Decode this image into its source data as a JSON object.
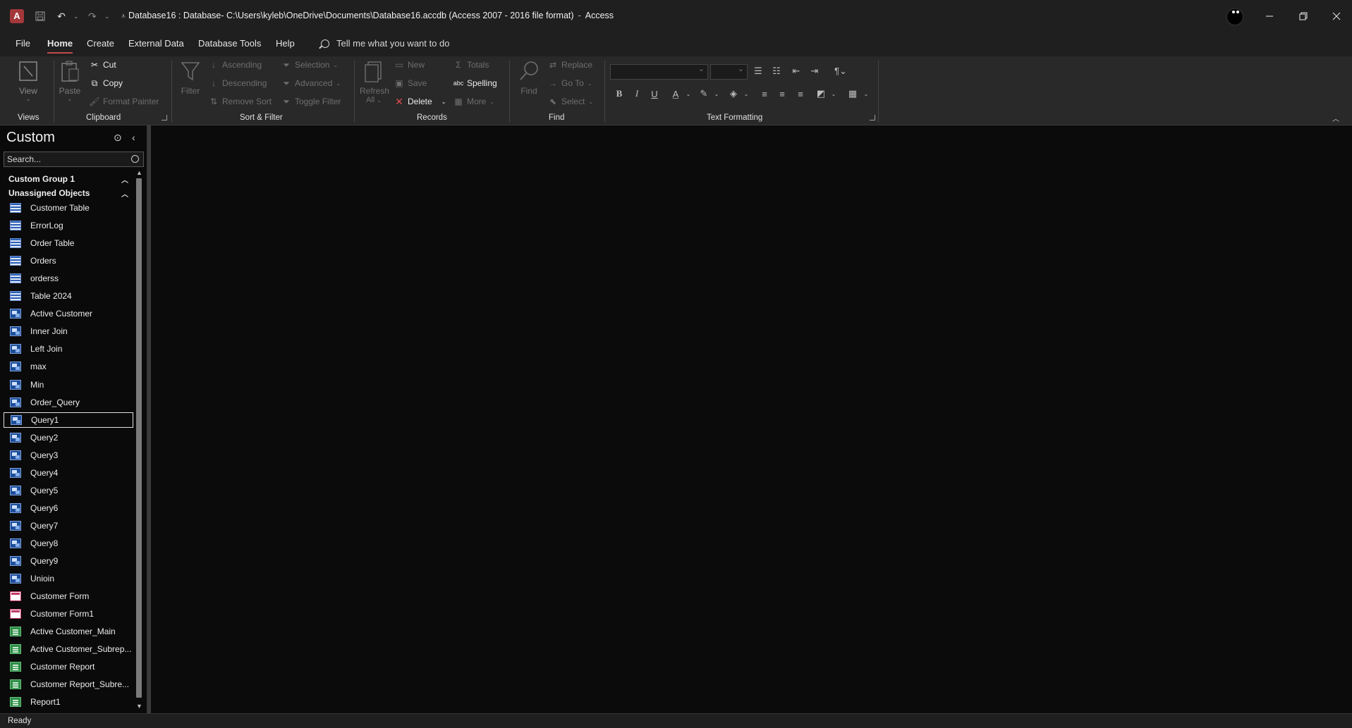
{
  "window": {
    "title_doc": "Database16 : Database- C:\\Users\\kyleb\\OneDrive\\Documents\\Database16.accdb (Access 2007 - 2016 file format)",
    "title_sep": "-",
    "title_app": "Access",
    "app_logo": "A"
  },
  "menu": {
    "tabs": [
      "File",
      "Home",
      "Create",
      "External Data",
      "Database Tools",
      "Help"
    ],
    "active_tab": "Home",
    "tellme_placeholder": "Tell me what you want to do"
  },
  "ribbon": {
    "views": {
      "view_label": "View",
      "group_label": "Views"
    },
    "clipboard": {
      "paste_label": "Paste",
      "cut_label": "Cut",
      "copy_label": "Copy",
      "format_painter_label": "Format Painter",
      "group_label": "Clipboard"
    },
    "sort_filter": {
      "filter_label": "Filter",
      "ascending_label": "Ascending",
      "descending_label": "Descending",
      "remove_sort_label": "Remove Sort",
      "selection_label": "Selection",
      "advanced_label": "Advanced",
      "toggle_filter_label": "Toggle Filter",
      "group_label": "Sort & Filter"
    },
    "records": {
      "refresh_label": "Refresh",
      "refresh_sub": "All",
      "new_label": "New",
      "save_label": "Save",
      "delete_label": "Delete",
      "totals_label": "Totals",
      "spelling_label": "Spelling",
      "more_label": "More",
      "group_label": "Records"
    },
    "find": {
      "find_label": "Find",
      "replace_label": "Replace",
      "goto_label": "Go To",
      "select_label": "Select",
      "group_label": "Find"
    },
    "text_formatting": {
      "bold": "B",
      "italic": "I",
      "underline": "U",
      "font_color": "A",
      "group_label": "Text Formatting"
    }
  },
  "nav": {
    "title": "Custom",
    "search_placeholder": "Search...",
    "groups": [
      {
        "label": "Custom Group 1"
      },
      {
        "label": "Unassigned Objects"
      }
    ],
    "items": [
      {
        "label": "Customer Table",
        "type": "table"
      },
      {
        "label": "ErrorLog",
        "type": "table"
      },
      {
        "label": "Order Table",
        "type": "table"
      },
      {
        "label": "Orders",
        "type": "table"
      },
      {
        "label": "orderss",
        "type": "table"
      },
      {
        "label": "Table 2024",
        "type": "table"
      },
      {
        "label": "Active Customer",
        "type": "query"
      },
      {
        "label": "Inner Join",
        "type": "query"
      },
      {
        "label": "Left Join",
        "type": "query"
      },
      {
        "label": "max",
        "type": "query"
      },
      {
        "label": "Min",
        "type": "query"
      },
      {
        "label": "Order_Query",
        "type": "query"
      },
      {
        "label": "Query1",
        "type": "query",
        "selected": true
      },
      {
        "label": "Query2",
        "type": "query"
      },
      {
        "label": "Query3",
        "type": "query"
      },
      {
        "label": "Query4",
        "type": "query"
      },
      {
        "label": "Query5",
        "type": "query"
      },
      {
        "label": "Query6",
        "type": "query"
      },
      {
        "label": "Query7",
        "type": "query"
      },
      {
        "label": "Query8",
        "type": "query"
      },
      {
        "label": "Query9",
        "type": "query"
      },
      {
        "label": "Unioin",
        "type": "query"
      },
      {
        "label": "Customer Form",
        "type": "form"
      },
      {
        "label": "Customer Form1",
        "type": "form"
      },
      {
        "label": "Active Customer_Main",
        "type": "report"
      },
      {
        "label": "Active Customer_Subrep...",
        "type": "report"
      },
      {
        "label": "Customer Report",
        "type": "report"
      },
      {
        "label": "Customer Report_Subre...",
        "type": "report"
      },
      {
        "label": "Report1",
        "type": "report"
      }
    ]
  },
  "status": {
    "text": "Ready"
  },
  "colors": {
    "accent": "#c14a4a",
    "titlebar": "#1f1f1f",
    "ribbon": "#292929",
    "background": "#0a0a0a"
  }
}
